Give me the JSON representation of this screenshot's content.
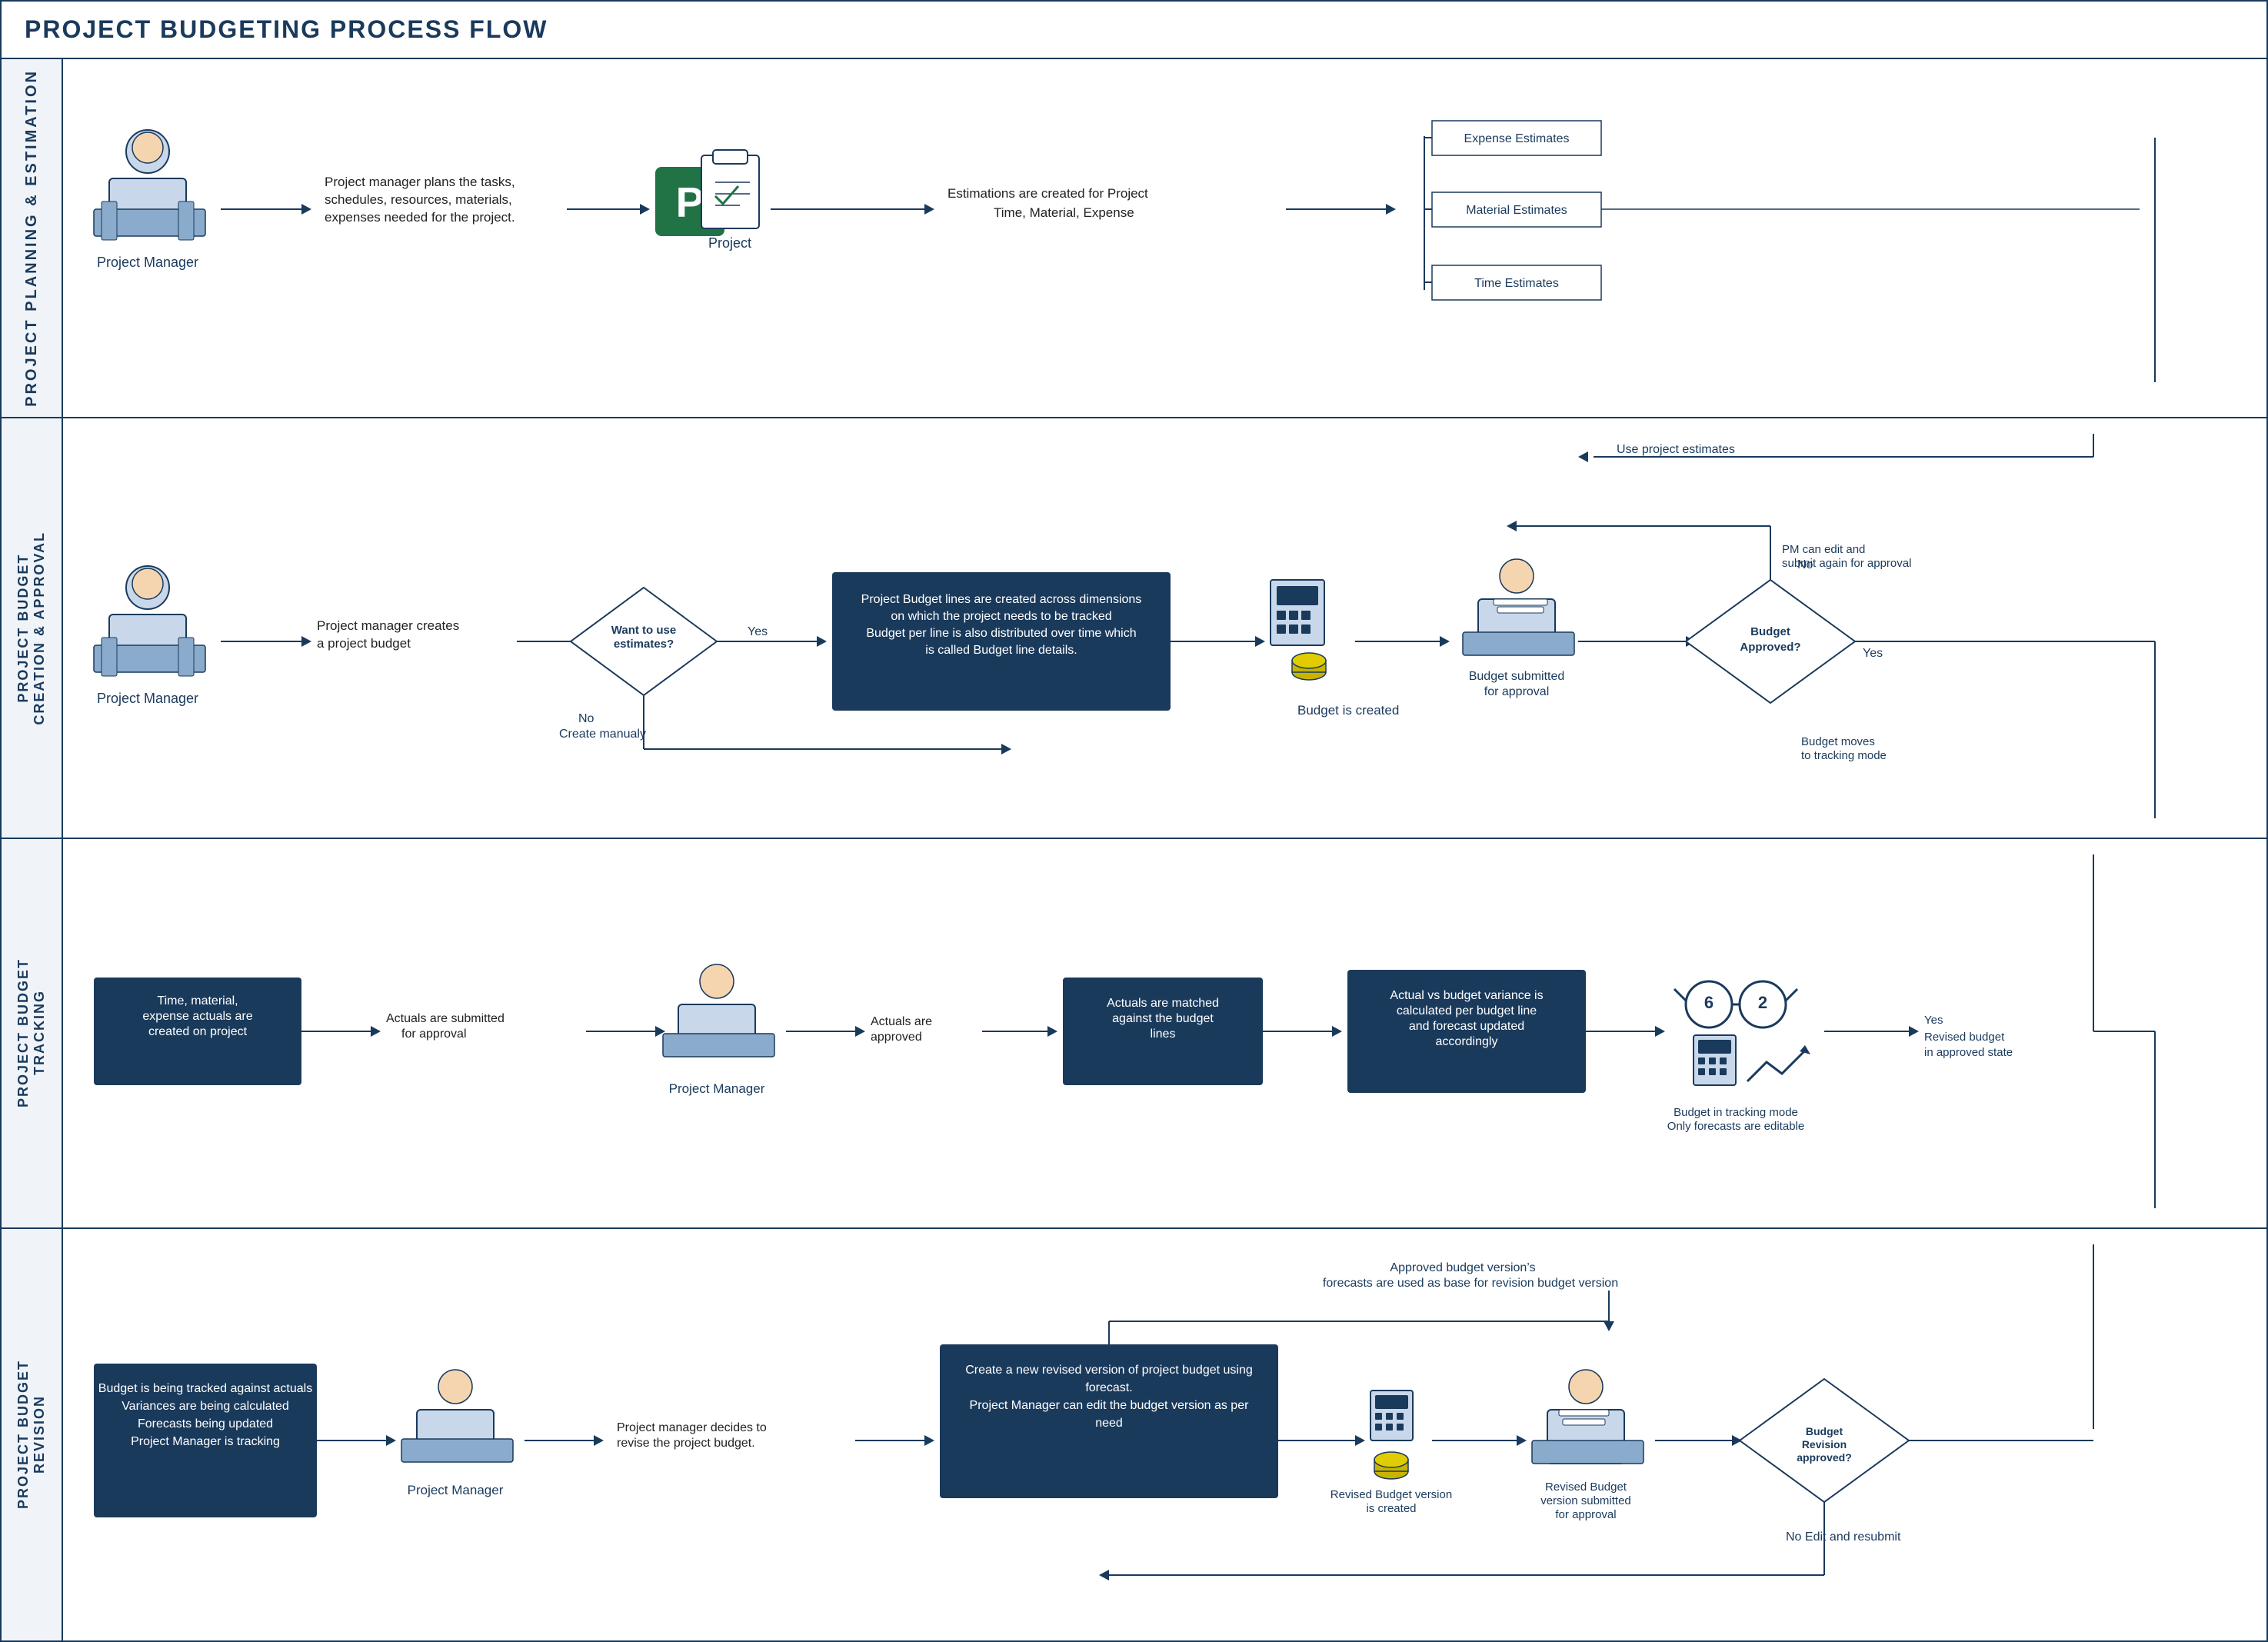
{
  "title": "PROJECT BUDGETING PROCESS FLOW",
  "lanes": [
    {
      "id": "lane1",
      "label": "PROJECT PLANNING & ESTIMATION",
      "actors": [
        "Project Manager"
      ],
      "steps": [
        "Project manager plans the tasks, schedules, resources, materials, expenses needed for the project.",
        "Estimations are created for Project Time, Material, Expense"
      ],
      "estimates": [
        "Expense Estimates",
        "Material Estimates",
        "Time Estimates"
      ]
    },
    {
      "id": "lane2",
      "label": "PROJECT BUDGET CREATION & APPROVAL",
      "actors": [
        "Project Manager"
      ],
      "steps": [
        "Project manager creates a project budget",
        "Want to use estimates?",
        "Project Budget lines are created across dimensions on which the project needs to be tracked Budget per line is also distributed over time which is called Budget line details.",
        "Budget is created",
        "Budget submitted for approval",
        "Budget Approved?"
      ],
      "notes": [
        "Use project estimates",
        "Yes",
        "No",
        "No\nCreate manualy",
        "No\nPM can edit and submit again for approval",
        "Yes\nBudget moves to tracking mode"
      ]
    },
    {
      "id": "lane3",
      "label": "PROJECT BUDGET TRACKING",
      "steps": [
        "Time, material, expense actuals are created on project",
        "Actuals are submitted for approval",
        "Actuals are approved",
        "Actuals are matched against the budget lines",
        "Actual vs budget variance is calculated per budget line and forecast updated accordingly",
        "Budget in tracking mode Only forecasts are editable",
        "Yes Revised budget in approved state"
      ]
    },
    {
      "id": "lane4",
      "label": "PROJECT BUDGET REVISION",
      "steps": [
        "Budget is being tracked against actuals Variances are being calculated Forecasts being updated Project Manager is tracking",
        "Project manager decides to revise the project budget.",
        "Create a new revised version of project budget using forecast. Project Manager can edit the budget version as per need",
        "Revised Budget version is created",
        "Revised Budget version submitted for approval",
        "Budget Revision approved?"
      ],
      "notes": [
        "Approved budget version's forecasts are used as base for revision budget version",
        "No Edit and resubmit"
      ]
    }
  ],
  "colors": {
    "dark_blue": "#1a3a5c",
    "mid_blue": "#1f4e79",
    "light_bg": "#f0f4f8",
    "white": "#ffffff",
    "accent_blue": "#2e75b6"
  }
}
